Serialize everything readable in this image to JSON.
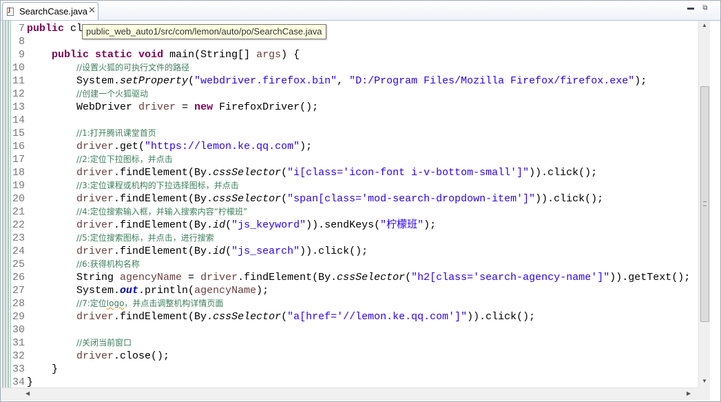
{
  "tab": {
    "label": "SearchCase.java",
    "close_glyph": "✕"
  },
  "tooltip": "public_web_auto1/src/com/lemon/auto/po/SearchCase.java",
  "window_buttons": {
    "minimize": "▬",
    "maximize": "⧉"
  },
  "scroll": {
    "up": "▲",
    "down": "▼",
    "left": "◀",
    "right": "▶"
  },
  "lines": [
    {
      "n": "7",
      "t": [
        {
          "k": "kw",
          "s": "public"
        },
        {
          "s": " cl"
        }
      ]
    },
    {
      "n": "8",
      "t": []
    },
    {
      "n": "9",
      "t": [
        {
          "s": "    "
        },
        {
          "k": "kw",
          "s": "public"
        },
        {
          "s": " "
        },
        {
          "k": "kw",
          "s": "static"
        },
        {
          "s": " "
        },
        {
          "k": "kw",
          "s": "void"
        },
        {
          "s": " main(String[] "
        },
        {
          "k": "lv",
          "s": "args"
        },
        {
          "s": ") {"
        }
      ]
    },
    {
      "n": "10",
      "t": [
        {
          "s": "        "
        },
        {
          "k": "cmt",
          "s": "//设置火狐的可执行文件的路径"
        }
      ]
    },
    {
      "n": "11",
      "t": [
        {
          "s": "        System."
        },
        {
          "k": "sm",
          "s": "setProperty"
        },
        {
          "s": "("
        },
        {
          "k": "str",
          "s": "\"webdriver.firefox.bin\""
        },
        {
          "s": ", "
        },
        {
          "k": "str",
          "s": "\"D:/Program Files/Mozilla Firefox/firefox.exe\""
        },
        {
          "s": ");"
        }
      ]
    },
    {
      "n": "12",
      "t": [
        {
          "s": "        "
        },
        {
          "k": "cmt",
          "s": "//创建一个火狐驱动"
        }
      ]
    },
    {
      "n": "13",
      "t": [
        {
          "s": "        WebDriver "
        },
        {
          "k": "lv",
          "s": "driver"
        },
        {
          "s": " = "
        },
        {
          "k": "kw",
          "s": "new"
        },
        {
          "s": " FirefoxDriver();"
        }
      ]
    },
    {
      "n": "14",
      "t": []
    },
    {
      "n": "15",
      "t": [
        {
          "s": "        "
        },
        {
          "k": "cmt",
          "s": "//1:打开腾讯课堂首页"
        }
      ]
    },
    {
      "n": "16",
      "t": [
        {
          "s": "        "
        },
        {
          "k": "lv",
          "s": "driver"
        },
        {
          "s": ".get("
        },
        {
          "k": "str",
          "s": "\"https://lemon.ke.qq.com\""
        },
        {
          "s": ");"
        }
      ]
    },
    {
      "n": "17",
      "t": [
        {
          "s": "        "
        },
        {
          "k": "cmt",
          "s": "//2:定位下拉图标，并点击"
        }
      ]
    },
    {
      "n": "18",
      "t": [
        {
          "s": "        "
        },
        {
          "k": "lv",
          "s": "driver"
        },
        {
          "s": ".findElement(By."
        },
        {
          "k": "sm",
          "s": "cssSelector"
        },
        {
          "s": "("
        },
        {
          "k": "str",
          "s": "\"i[class='icon-font i-v-bottom-small']\""
        },
        {
          "s": ")).click();"
        }
      ]
    },
    {
      "n": "19",
      "t": [
        {
          "s": "        "
        },
        {
          "k": "cmt",
          "s": "//3:定位课程或机构的下拉选择图标，并点击"
        }
      ]
    },
    {
      "n": "20",
      "t": [
        {
          "s": "        "
        },
        {
          "k": "lv",
          "s": "driver"
        },
        {
          "s": ".findElement(By."
        },
        {
          "k": "sm",
          "s": "cssSelector"
        },
        {
          "s": "("
        },
        {
          "k": "str",
          "s": "\"span[class='mod-search-dropdown-item']\""
        },
        {
          "s": ")).click();"
        }
      ]
    },
    {
      "n": "21",
      "t": [
        {
          "s": "        "
        },
        {
          "k": "cmt",
          "s": "//4:定位搜索输入框，并输入搜索内容“柠檬班”"
        }
      ]
    },
    {
      "n": "22",
      "t": [
        {
          "s": "        "
        },
        {
          "k": "lv",
          "s": "driver"
        },
        {
          "s": ".findElement(By."
        },
        {
          "k": "sm",
          "s": "id"
        },
        {
          "s": "("
        },
        {
          "k": "str",
          "s": "\"js_keyword\""
        },
        {
          "s": ")).sendKeys("
        },
        {
          "k": "str",
          "s": "\"柠檬班\""
        },
        {
          "s": ");"
        }
      ]
    },
    {
      "n": "23",
      "t": [
        {
          "s": "        "
        },
        {
          "k": "cmt",
          "s": "//5:定位搜索图标，并点击，进行搜索"
        }
      ]
    },
    {
      "n": "24",
      "t": [
        {
          "s": "        "
        },
        {
          "k": "lv",
          "s": "driver"
        },
        {
          "s": ".findElement(By."
        },
        {
          "k": "sm",
          "s": "id"
        },
        {
          "s": "("
        },
        {
          "k": "str",
          "s": "\"js_search\""
        },
        {
          "s": ")).click();"
        }
      ]
    },
    {
      "n": "25",
      "t": [
        {
          "s": "        "
        },
        {
          "k": "cmt",
          "s": "//6:获得机构名称"
        }
      ]
    },
    {
      "n": "26",
      "t": [
        {
          "s": "        String "
        },
        {
          "k": "lv",
          "s": "agencyName"
        },
        {
          "s": " = "
        },
        {
          "k": "lv",
          "s": "driver"
        },
        {
          "s": ".findElement(By."
        },
        {
          "k": "sm",
          "s": "cssSelector"
        },
        {
          "s": "("
        },
        {
          "k": "str",
          "s": "\"h2[class='search-agency-name']\""
        },
        {
          "s": ")).getText();"
        }
      ]
    },
    {
      "n": "27",
      "t": [
        {
          "s": "        System."
        },
        {
          "k": "fld",
          "s": "out"
        },
        {
          "s": ".println("
        },
        {
          "k": "lv",
          "s": "agencyName"
        },
        {
          "s": ");"
        }
      ]
    },
    {
      "n": "28",
      "t": [
        {
          "s": "        "
        },
        {
          "k": "cmt",
          "s": "//7:定位"
        },
        {
          "k": "cmt squig",
          "s": "logo"
        },
        {
          "k": "cmt",
          "s": "，并点击调整机构详情页面"
        }
      ]
    },
    {
      "n": "29",
      "t": [
        {
          "s": "        "
        },
        {
          "k": "lv",
          "s": "driver"
        },
        {
          "s": ".findElement(By."
        },
        {
          "k": "sm",
          "s": "cssSelector"
        },
        {
          "s": "("
        },
        {
          "k": "str",
          "s": "\"a[href='//lemon.ke.qq.com']\""
        },
        {
          "s": ")).click();"
        }
      ]
    },
    {
      "n": "30",
      "t": []
    },
    {
      "n": "31",
      "t": [
        {
          "s": "        "
        },
        {
          "k": "cmt",
          "s": "//关闭当前窗口"
        }
      ]
    },
    {
      "n": "32",
      "t": [
        {
          "s": "        "
        },
        {
          "k": "lv",
          "s": "driver"
        },
        {
          "s": ".close();"
        }
      ]
    },
    {
      "n": "33",
      "t": [
        {
          "s": "    }"
        }
      ]
    },
    {
      "n": "34",
      "t": [
        {
          "s": "}"
        }
      ]
    }
  ]
}
